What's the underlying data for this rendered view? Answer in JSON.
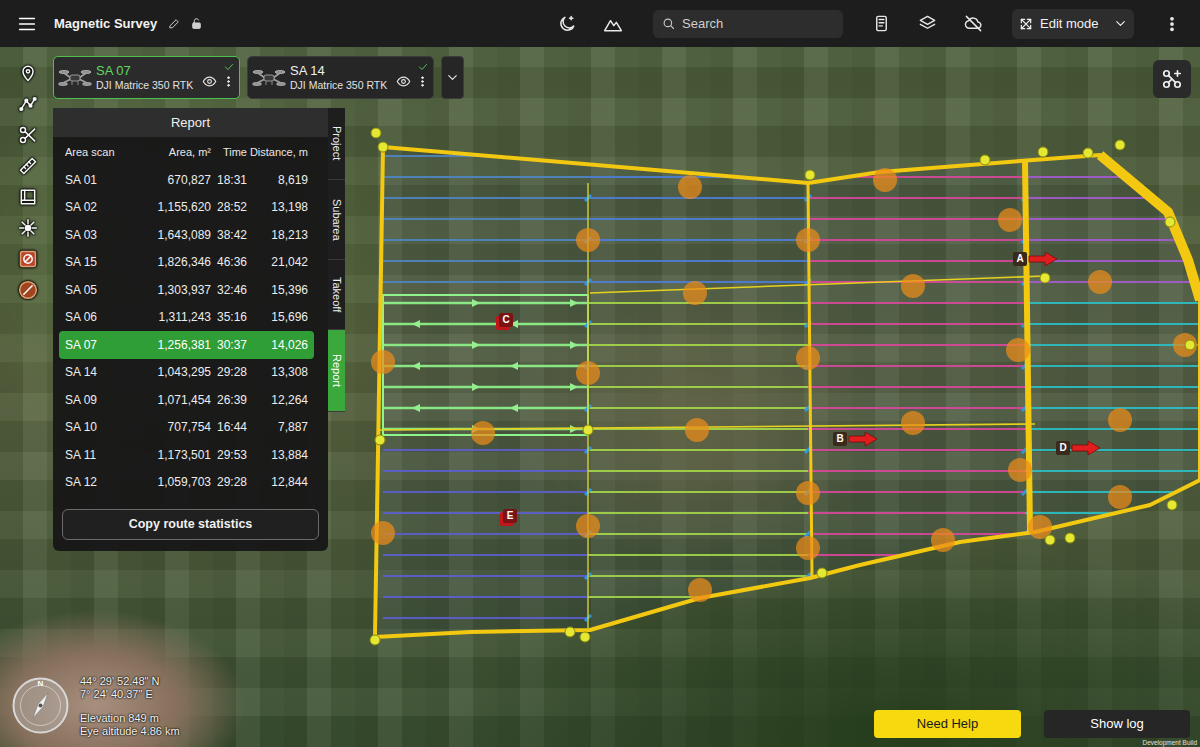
{
  "project": {
    "title": "Magnetic Survey"
  },
  "search": {
    "placeholder": "Search"
  },
  "mode": {
    "label": "Edit mode"
  },
  "drones": [
    {
      "name": "SA 07",
      "model": "DJI Matrice 350 RTK",
      "selected": true,
      "ready": true
    },
    {
      "name": "SA 14",
      "model": "DJI Matrice 350 RTK",
      "selected": false,
      "ready": true
    }
  ],
  "panel": {
    "title": "Report",
    "tabs": [
      {
        "label": "Project",
        "selected": false
      },
      {
        "label": "Subarea",
        "selected": false
      },
      {
        "label": "Takeoff",
        "selected": false
      },
      {
        "label": "Report",
        "selected": true
      }
    ],
    "action": "Copy route statistics"
  },
  "table": {
    "columns": [
      "Area scan",
      "Area, m²",
      "Time",
      "Distance, m"
    ],
    "rows": [
      {
        "cells": [
          "SA 01",
          "670,827",
          "18:31",
          "8,619"
        ],
        "selected": false
      },
      {
        "cells": [
          "SA 02",
          "1,155,620",
          "28:52",
          "13,198"
        ],
        "selected": false
      },
      {
        "cells": [
          "SA 03",
          "1,643,089",
          "38:42",
          "18,213"
        ],
        "selected": false
      },
      {
        "cells": [
          "SA 15",
          "1,826,346",
          "46:36",
          "21,042"
        ],
        "selected": false
      },
      {
        "cells": [
          "SA 05",
          "1,303,937",
          "32:46",
          "15,396"
        ],
        "selected": false
      },
      {
        "cells": [
          "SA 06",
          "1,311,243",
          "35:16",
          "15,696"
        ],
        "selected": false
      },
      {
        "cells": [
          "SA 07",
          "1,256,381",
          "30:37",
          "14,026"
        ],
        "selected": true
      },
      {
        "cells": [
          "SA 14",
          "1,043,295",
          "29:28",
          "13,308"
        ],
        "selected": false
      },
      {
        "cells": [
          "SA 09",
          "1,071,454",
          "26:39",
          "12,264"
        ],
        "selected": false
      },
      {
        "cells": [
          "SA 10",
          "707,754",
          "16:44",
          "7,887"
        ],
        "selected": false
      },
      {
        "cells": [
          "SA 11",
          "1,173,501",
          "29:53",
          "13,884"
        ],
        "selected": false
      },
      {
        "cells": [
          "SA 12",
          "1,059,703",
          "29:28",
          "12,844"
        ],
        "selected": false
      }
    ]
  },
  "map": {
    "markers": [
      {
        "label": "A",
        "kind": "arrow"
      },
      {
        "label": "B",
        "kind": "arrow"
      },
      {
        "label": "C",
        "kind": "pin"
      },
      {
        "label": "D",
        "kind": "arrow"
      },
      {
        "label": "E",
        "kind": "pin"
      }
    ]
  },
  "compass": {
    "label": "N"
  },
  "status": {
    "latitude": "44° 29' 52.48\" N",
    "longitude": "7° 24' 40.37\" E",
    "elevation": "Elevation 849 m",
    "eye_altitude": "Eye altitude 4.86 km"
  },
  "buttons": {
    "help": "Need Help",
    "log": "Show log"
  },
  "build": "Development Build"
}
